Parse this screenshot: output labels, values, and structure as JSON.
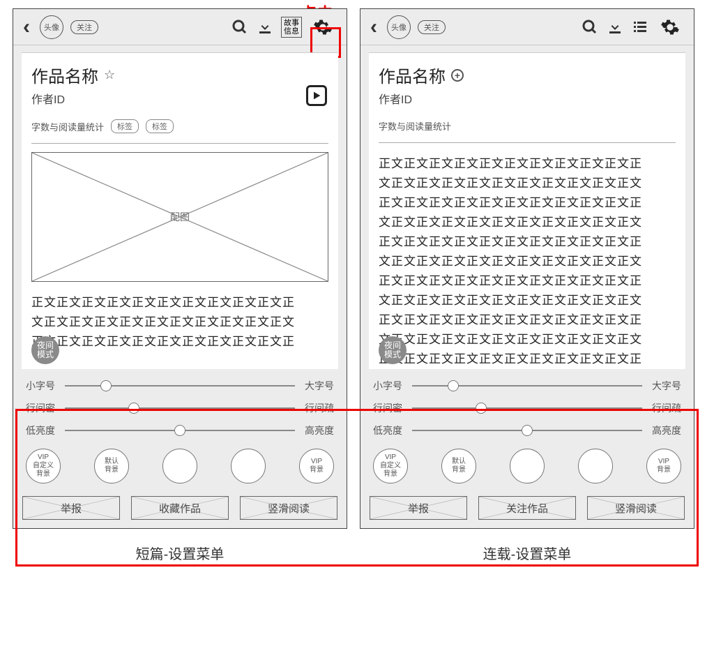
{
  "annotation": {
    "click_label": "点击"
  },
  "topbar": {
    "avatar_label": "头像",
    "follow_label": "关注",
    "story_info_line1": "故事",
    "story_info_line2": "信息"
  },
  "work": {
    "title": "作品名称",
    "author": "作者ID",
    "stats": "字数与阅读量统计",
    "tag_label": "标签",
    "image_placeholder": "配图",
    "body_line": "正文正文正文正文正文正文正文正文正文正文正",
    "body_line_alt": "文正文正文正文正文正文正文正文正文正文正文",
    "night_mode": "夜间\n模式"
  },
  "settings": {
    "sliders": [
      {
        "left": "小字号",
        "right": "大字号",
        "pos": 18
      },
      {
        "left": "行间密",
        "right": "行间疏",
        "pos": 30
      },
      {
        "left": "低亮度",
        "right": "高亮度",
        "pos": 50
      }
    ],
    "bg_options": [
      "VIP\n自定义\n背景",
      "默认\n背景",
      "",
      "",
      "VIP\n背景"
    ]
  },
  "bottom_short": [
    "举报",
    "收藏作品",
    "竖滑阅读"
  ],
  "bottom_serial": [
    "举报",
    "关注作品",
    "竖滑阅读"
  ],
  "captions": {
    "short": "短篇-设置菜单",
    "serial": "连载-设置菜单"
  }
}
